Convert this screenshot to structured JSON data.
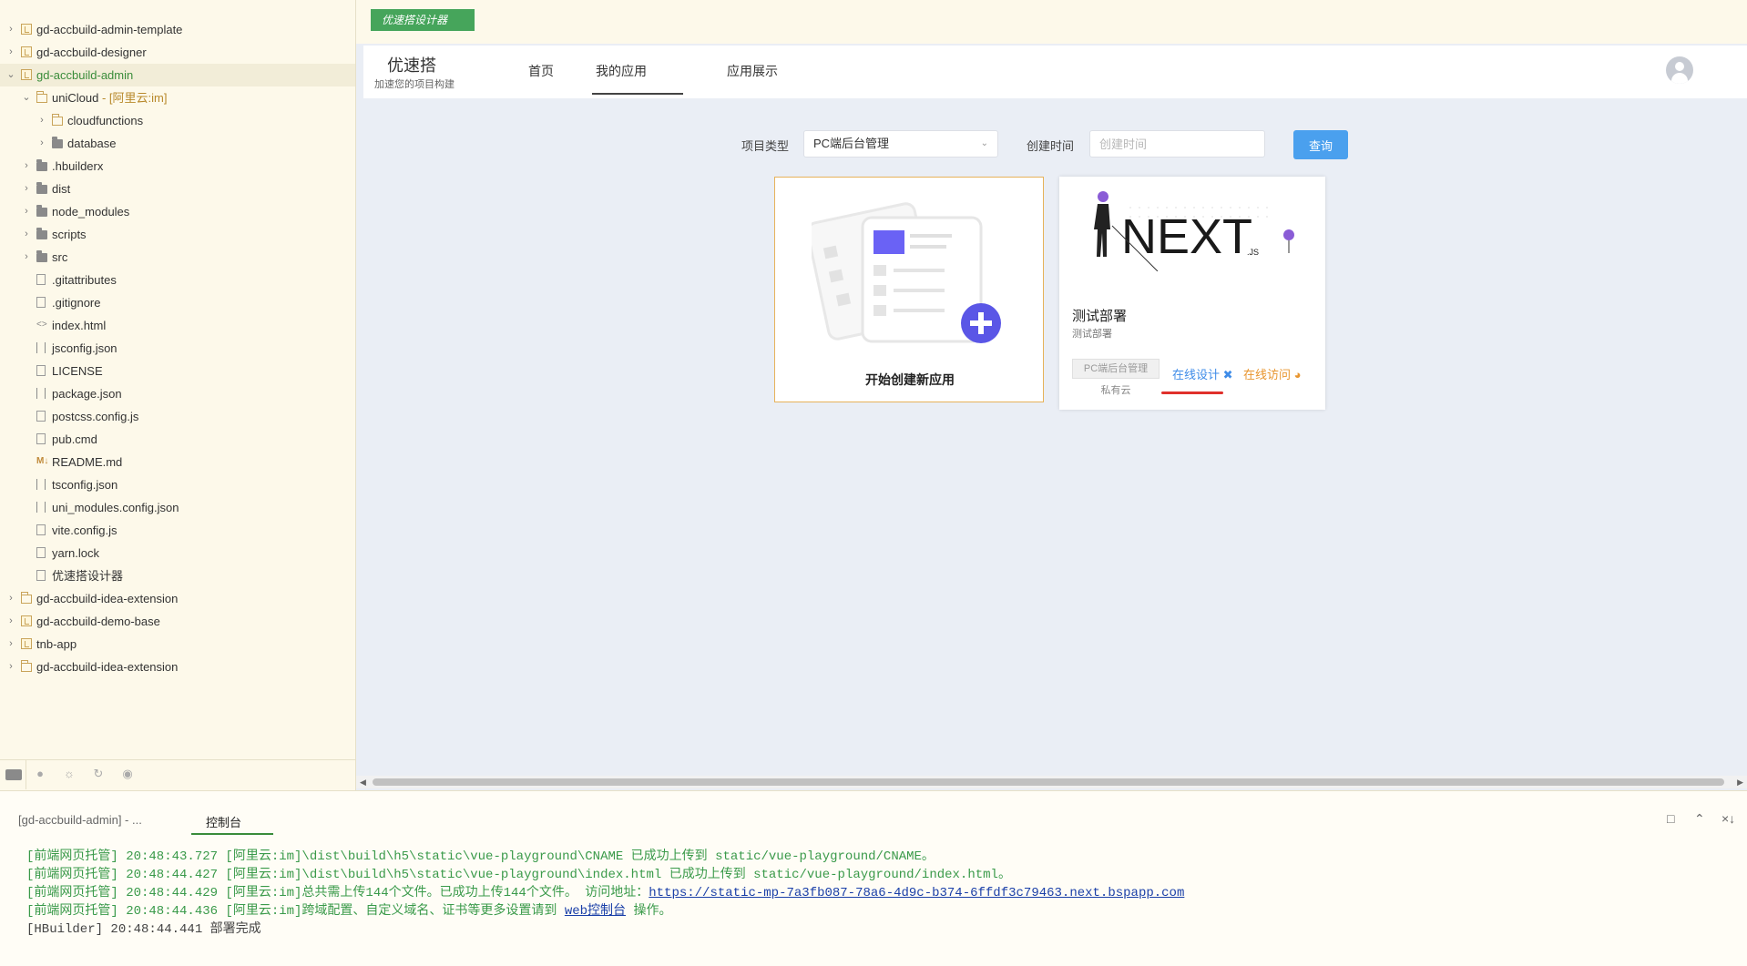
{
  "explorer": {
    "items": [
      {
        "label": "gd-accbuild-admin-template",
        "sub": "",
        "indent": 0,
        "icon": "project-icon",
        "expanded": false,
        "active": false
      },
      {
        "label": "gd-accbuild-designer",
        "sub": "",
        "indent": 0,
        "icon": "project-icon",
        "expanded": false,
        "active": false
      },
      {
        "label": "gd-accbuild-admin",
        "sub": "",
        "indent": 0,
        "icon": "project-icon",
        "expanded": true,
        "active": true
      },
      {
        "label": "uniCloud",
        "sub": " - [阿里云:im]",
        "indent": 1,
        "icon": "cloud-folder-icon",
        "expanded": true,
        "active": false
      },
      {
        "label": "cloudfunctions",
        "sub": "",
        "indent": 2,
        "icon": "folder-open-icon",
        "expanded": false,
        "active": false
      },
      {
        "label": "database",
        "sub": "",
        "indent": 2,
        "icon": "folder-icon",
        "expanded": false,
        "active": false
      },
      {
        "label": ".hbuilderx",
        "sub": "",
        "indent": 1,
        "icon": "folder-icon",
        "expanded": false,
        "active": false
      },
      {
        "label": "dist",
        "sub": "",
        "indent": 1,
        "icon": "folder-icon",
        "expanded": false,
        "active": false
      },
      {
        "label": "node_modules",
        "sub": "",
        "indent": 1,
        "icon": "folder-icon",
        "expanded": false,
        "active": false
      },
      {
        "label": "scripts",
        "sub": "",
        "indent": 1,
        "icon": "folder-icon",
        "expanded": false,
        "active": false
      },
      {
        "label": "src",
        "sub": "",
        "indent": 1,
        "icon": "folder-icon",
        "expanded": false,
        "active": false
      },
      {
        "label": ".gitattributes",
        "sub": "",
        "indent": 1,
        "icon": "file-icon",
        "expanded": null,
        "active": false
      },
      {
        "label": ".gitignore",
        "sub": "",
        "indent": 1,
        "icon": "file-icon",
        "expanded": null,
        "active": false
      },
      {
        "label": "index.html",
        "sub": "",
        "indent": 1,
        "icon": "code-icon",
        "expanded": null,
        "active": false
      },
      {
        "label": "jsconfig.json",
        "sub": "",
        "indent": 1,
        "icon": "json-icon",
        "expanded": null,
        "active": false
      },
      {
        "label": "LICENSE",
        "sub": "",
        "indent": 1,
        "icon": "file-icon",
        "expanded": null,
        "active": false
      },
      {
        "label": "package.json",
        "sub": "",
        "indent": 1,
        "icon": "json-icon",
        "expanded": null,
        "active": false
      },
      {
        "label": "postcss.config.js",
        "sub": "",
        "indent": 1,
        "icon": "js-file-icon",
        "expanded": null,
        "active": false
      },
      {
        "label": "pub.cmd",
        "sub": "",
        "indent": 1,
        "icon": "file-icon",
        "expanded": null,
        "active": false
      },
      {
        "label": "README.md",
        "sub": "",
        "indent": 1,
        "icon": "markdown-icon",
        "expanded": null,
        "active": false
      },
      {
        "label": "tsconfig.json",
        "sub": "",
        "indent": 1,
        "icon": "json-icon",
        "expanded": null,
        "active": false
      },
      {
        "label": "uni_modules.config.json",
        "sub": "",
        "indent": 1,
        "icon": "json-icon",
        "expanded": null,
        "active": false
      },
      {
        "label": "vite.config.js",
        "sub": "",
        "indent": 1,
        "icon": "js-file-icon",
        "expanded": null,
        "active": false
      },
      {
        "label": "yarn.lock",
        "sub": "",
        "indent": 1,
        "icon": "file-icon",
        "expanded": null,
        "active": false
      },
      {
        "label": "优速搭设计器",
        "sub": "",
        "indent": 1,
        "icon": "file-icon",
        "expanded": null,
        "active": false
      },
      {
        "label": "gd-accbuild-idea-extension",
        "sub": "",
        "indent": 0,
        "icon": "folder-project-icon",
        "expanded": false,
        "active": false
      },
      {
        "label": "gd-accbuild-demo-base",
        "sub": "",
        "indent": 0,
        "icon": "project-icon",
        "expanded": false,
        "active": false
      },
      {
        "label": "tnb-app",
        "sub": "",
        "indent": 0,
        "icon": "project-icon",
        "expanded": false,
        "active": false
      },
      {
        "label": "gd-accbuild-idea-extension",
        "sub": "",
        "indent": 0,
        "icon": "folder-project-icon",
        "expanded": false,
        "active": false
      }
    ],
    "bottom_icons": [
      "explorer-icon",
      "gamepad-icon",
      "bug-icon",
      "sync-icon",
      "palette-icon"
    ]
  },
  "app": {
    "designer_chip": "优速搭设计器",
    "brand_title": "优速搭",
    "brand_sub": "加速您的项目构建",
    "nav": {
      "home": "首页",
      "mine": "我的应用",
      "show": "应用展示"
    },
    "filter": {
      "type_label": "项目类型",
      "type_value": "PC端后台管理",
      "time_label": "创建时间",
      "time_placeholder": "创建时间",
      "query": "查询"
    },
    "create_card": {
      "label": "开始创建新应用"
    },
    "app_card": {
      "name": "测试部署",
      "desc": "测试部署",
      "tag": "PC端后台管理",
      "cloud": "私有云",
      "design": "在线设计",
      "visit": "在线访问",
      "thumb_text": "NEXT",
      "thumb_sub": ".JS"
    }
  },
  "console": {
    "project_tab": "[gd-accbuild-admin] - ...",
    "tab": "控制台",
    "lines": [
      {
        "text": "[前端网页托管] 20:48:43.727 [阿里云:im]\\dist\\build\\h5\\static\\vue-playground\\CNAME 已成功上传到 static/vue-playground/CNAME。"
      },
      {
        "text": "[前端网页托管] 20:48:44.427 [阿里云:im]\\dist\\build\\h5\\static\\vue-playground\\index.html 已成功上传到 static/vue-playground/index.html。"
      },
      {
        "text": "[前端网页托管] 20:48:44.429 [阿里云:im]总共需上传144个文件。已成功上传144个文件。  访问地址：",
        "link": "https://static-mp-7a3fb087-78a6-4d9c-b374-6ffdf3c79463.next.bspapp.com"
      },
      {
        "text": "[前端网页托管] 20:48:44.436 [阿里云:im]跨域配置、自定义域名、证书等更多设置请到 ",
        "link": "web控制台",
        "tail": " 操作。"
      },
      {
        "text": "[HBuilder] 20:48:44.441 部署完成",
        "done": true
      }
    ]
  },
  "colors": {
    "accent_green": "#46a55b",
    "query_blue": "#4aa0ee",
    "design_blue": "#3f8ce8",
    "visit_orange": "#e8952e",
    "console_green": "#3a9a4a",
    "red_underline": "#e0302b"
  }
}
